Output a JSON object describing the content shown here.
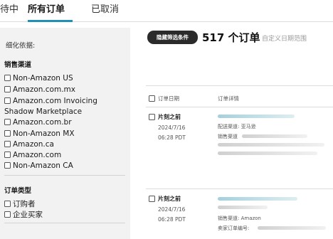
{
  "tabs": {
    "pending": "待中",
    "all": "所有订单",
    "cancelled": "已取消"
  },
  "sidebar": {
    "refine_label": "细化依据:",
    "channel_title": "销售渠道",
    "channels": [
      "Non-Amazon US",
      "Amazon.com.mx",
      "Amazon.com Invoicing Shadow Marketplace",
      "Amazon.com.br",
      "Non-Amazon MX",
      "Amazon.ca",
      "Amazon.com",
      "Non-Amazon CA"
    ],
    "order_type_title": "订单类型",
    "order_types": [
      "订购者",
      "企业买家"
    ]
  },
  "main": {
    "hide_filters_button": "隐藏筛选条件",
    "order_count": "517 个订单",
    "date_range_label": "自定义日期范围",
    "columns": {
      "order_date": "订单日期",
      "order_details": "订单详情"
    },
    "orders": [
      {
        "time_label": "片刻之前",
        "date": "2024/7/16",
        "time": "06:28 PDT",
        "line2": "配送渠道: 亚马逊",
        "line3": "销售渠道"
      },
      {
        "time_label": "片刻之前",
        "date": "2024/7/16",
        "time": "06:28 PDT",
        "line2": "销售渠道: Amazon",
        "line3": "卖家订单编号:"
      }
    ]
  },
  "colors": {
    "accent_underline": "#1f8fb5",
    "pill_background": "#2b2b2b",
    "sidebar_background": "#f2f2f2"
  }
}
